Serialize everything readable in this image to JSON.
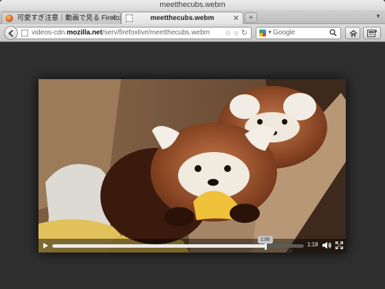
{
  "window": {
    "title": "meetthecubs.webm"
  },
  "tabs": [
    {
      "label": "可愛すぎ注意｜動画で見る Firefox",
      "close": "✕",
      "icon": "firefox-icon"
    },
    {
      "label": "meetthecubs.webm",
      "close": "✕",
      "icon": "blank-document-icon"
    }
  ],
  "new_tab_label": "+",
  "navbar": {
    "url_prefix": "videos-cdn.",
    "url_domain": "mozilla.net",
    "url_path": "/serv/firefoxlive/meetthecubs.webm",
    "search_placeholder": "Google"
  },
  "video": {
    "current_time": "1:06",
    "duration": "1:18",
    "progress": 0.846
  },
  "colors": {
    "page_background": "#2f2f2f",
    "controls_background": "#000000"
  }
}
